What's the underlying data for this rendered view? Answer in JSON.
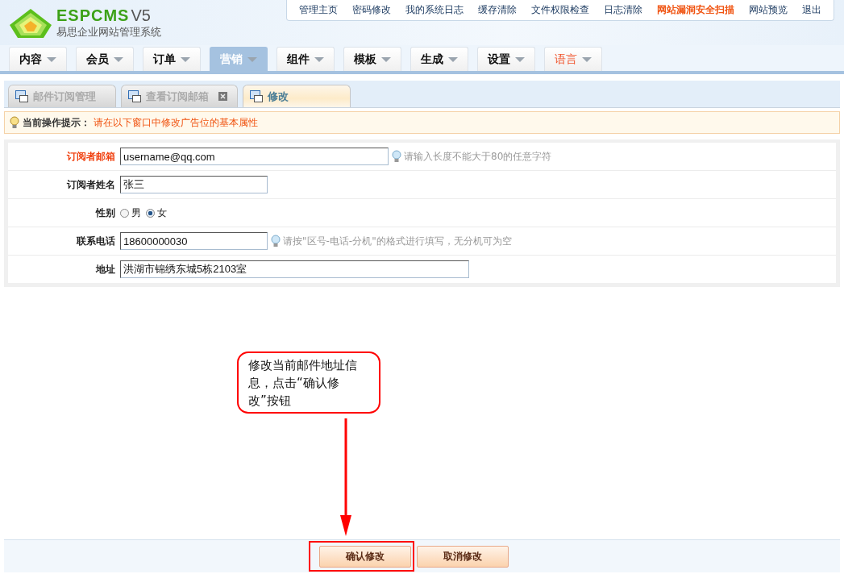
{
  "logo": {
    "brand": "ESPCMS",
    "version": "V5",
    "subtitle": "易思企业网站管理系统"
  },
  "top_links": [
    {
      "label": "管理主页",
      "kind": "normal"
    },
    {
      "label": "密码修改",
      "kind": "normal"
    },
    {
      "label": "我的系统日志",
      "kind": "normal"
    },
    {
      "label": "缓存清除",
      "kind": "normal"
    },
    {
      "label": "文件权限检查",
      "kind": "normal"
    },
    {
      "label": "日志清除",
      "kind": "normal"
    },
    {
      "label": "网站漏洞安全扫描",
      "kind": "alert"
    },
    {
      "label": "网站预览",
      "kind": "normal"
    },
    {
      "label": "退出",
      "kind": "normal"
    }
  ],
  "nav_tabs": [
    {
      "label": "内容",
      "selected": false,
      "kind": "normal"
    },
    {
      "label": "会员",
      "selected": false,
      "kind": "normal"
    },
    {
      "label": "订单",
      "selected": false,
      "kind": "normal"
    },
    {
      "label": "营销",
      "selected": true,
      "kind": "normal"
    },
    {
      "label": "组件",
      "selected": false,
      "kind": "normal"
    },
    {
      "label": "模板",
      "selected": false,
      "kind": "normal"
    },
    {
      "label": "生成",
      "selected": false,
      "kind": "normal"
    },
    {
      "label": "设置",
      "selected": false,
      "kind": "normal"
    },
    {
      "label": "语言",
      "selected": false,
      "kind": "alert"
    }
  ],
  "sub_tabs": [
    {
      "label": "邮件订阅管理",
      "selected": false,
      "closable": false
    },
    {
      "label": "查看订阅邮箱",
      "selected": false,
      "closable": true
    },
    {
      "label": "修改",
      "selected": true,
      "closable": false
    }
  ],
  "hint_bar": {
    "label": "当前操作提示：",
    "text": "请在以下窗口中修改广告位的基本属性"
  },
  "form_rows": [
    {
      "kind": "text",
      "label": "订阅者邮箱",
      "required": true,
      "value": "username@qq.com",
      "hint": "请输入长度不能大于80的任意字符"
    },
    {
      "kind": "text",
      "label": "订阅者姓名",
      "required": false,
      "value": "张三"
    },
    {
      "kind": "radio",
      "label": "性别",
      "required": false,
      "options": [
        {
          "label": "男",
          "selected": false
        },
        {
          "label": "女",
          "selected": true
        }
      ]
    },
    {
      "kind": "text",
      "label": "联系电话",
      "required": false,
      "value": "18600000030",
      "hint": "请按\"区号-电话-分机\"的格式进行填写，无分机可为空"
    },
    {
      "kind": "text",
      "label": "地址",
      "required": false,
      "value": "洪湖市锦绣东城5栋2103室"
    }
  ],
  "callout": {
    "text": "修改当前邮件地址信息，点击“确认修改”按钮"
  },
  "buttons": [
    {
      "label": "确认修改",
      "highlighted": true
    },
    {
      "label": "取消修改",
      "highlighted": false
    }
  ]
}
